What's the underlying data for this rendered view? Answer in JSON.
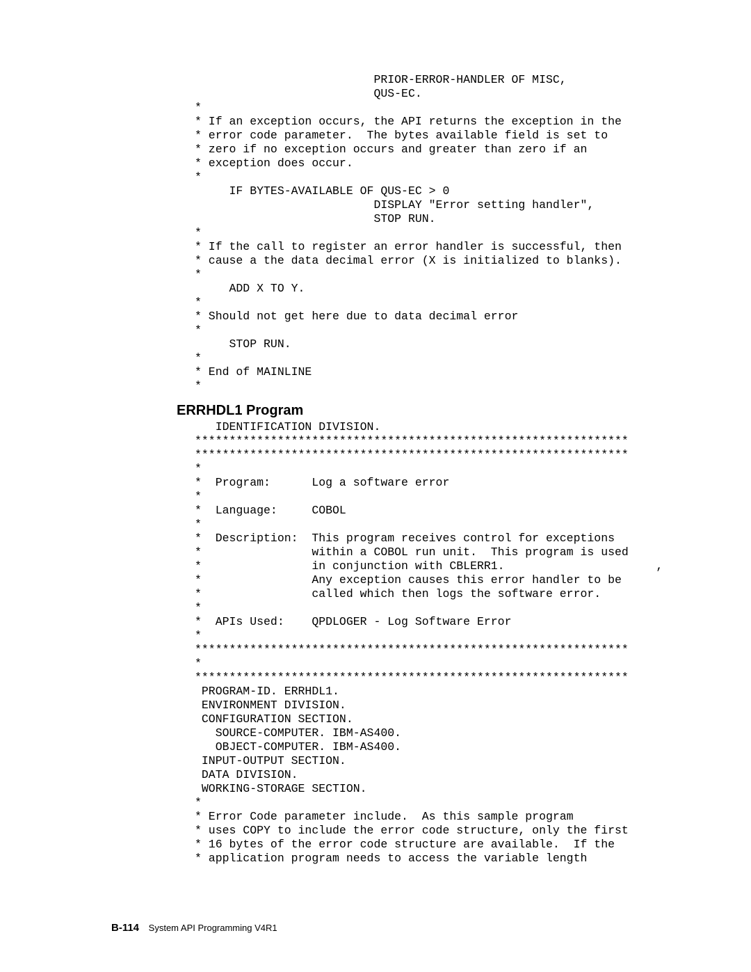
{
  "code1": "                          PRIOR-ERROR-HANDLER OF MISC,\n                          QUS-EC.\n*\n* If an exception occurs, the API returns the exception in the\n* error code parameter.  The bytes available field is set to\n* zero if no exception occurs and greater than zero if an\n* exception does occur.\n*\n     IF BYTES-AVAILABLE OF QUS-EC > 0\n                          DISPLAY \"Error setting handler\",\n                          STOP RUN.\n*\n* If the call to register an error handler is successful, then\n* cause a the data decimal error (X is initialized to blanks).\n*\n     ADD X TO Y.\n*\n* Should not get here due to data decimal error\n*\n     STOP RUN.\n*\n* End of MAINLINE\n*",
  "heading": "ERRHDL1 Program",
  "code2": "   IDENTIFICATION DIVISION.\n***************************************************************\n***************************************************************\n*\n*  Program:      Log a software error\n*\n*  Language:     COBOL\n*\n*  Description:  This program receives control for exceptions\n*                within a COBOL run unit.  This program is used\n*                in conjunction with CBLERR1.                      ,\n*                Any exception causes this error handler to be\n*                called which then logs the software error.\n*\n*  APIs Used:    QPDLOGER - Log Software Error\n*\n***************************************************************\n*\n***************************************************************\n PROGRAM-ID. ERRHDL1.\n ENVIRONMENT DIVISION.\n CONFIGURATION SECTION.\n   SOURCE-COMPUTER. IBM-AS400.\n   OBJECT-COMPUTER. IBM-AS400.\n INPUT-OUTPUT SECTION.\n DATA DIVISION.\n WORKING-STORAGE SECTION.\n*\n* Error Code parameter include.  As this sample program\n* uses COPY to include the error code structure, only the first\n* 16 bytes of the error code structure are available.  If the\n* application program needs to access the variable length",
  "footer_page": "B-114",
  "footer_text": "System API Programming V4R1"
}
